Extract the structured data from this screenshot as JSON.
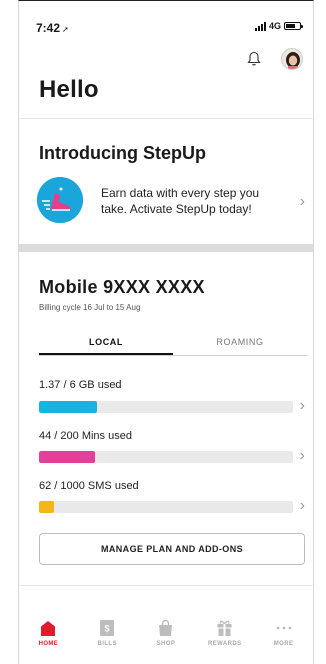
{
  "status_bar": {
    "time": "7:42",
    "location_glyph": "➚",
    "network": "4G",
    "battery_level": 0.7
  },
  "header": {
    "greeting": "Hello"
  },
  "promo": {
    "title": "Introducing StepUp",
    "text": "Earn data with every step you take. Activate StepUp today!",
    "icon": "stepup-shoe-icon"
  },
  "mobile": {
    "title": "Mobile 9XXX XXXX",
    "billing_cycle": "Billing cycle 16 Jul to 15 Aug",
    "tabs": [
      {
        "label": "LOCAL",
        "active": true
      },
      {
        "label": "ROAMING",
        "active": false
      }
    ],
    "usage": [
      {
        "label": "1.37 / 6 GB used",
        "fraction": 0.23,
        "color": "#17b4e0"
      },
      {
        "label": "44 / 200 Mins used",
        "fraction": 0.22,
        "color": "#e2409a"
      },
      {
        "label": "62 / 1000 SMS used",
        "fraction": 0.06,
        "color": "#f7b51c"
      }
    ],
    "manage_label": "MANAGE PLAN AND ADD-ONS"
  },
  "nav": {
    "items": [
      {
        "label": "HOME",
        "icon": "home-icon",
        "active": true
      },
      {
        "label": "BILLS",
        "icon": "bills-icon",
        "active": false
      },
      {
        "label": "SHOP",
        "icon": "shop-bag-icon",
        "active": false
      },
      {
        "label": "REWARDS",
        "icon": "gift-icon",
        "active": false
      },
      {
        "label": "MORE",
        "icon": "more-dots-icon",
        "active": false
      }
    ],
    "active_color": "#e11b2b",
    "inactive_color": "#bdbdbd"
  },
  "colors": {
    "chevron": "#9a9a9a",
    "promo_icon_bg": "#1ba6db"
  }
}
